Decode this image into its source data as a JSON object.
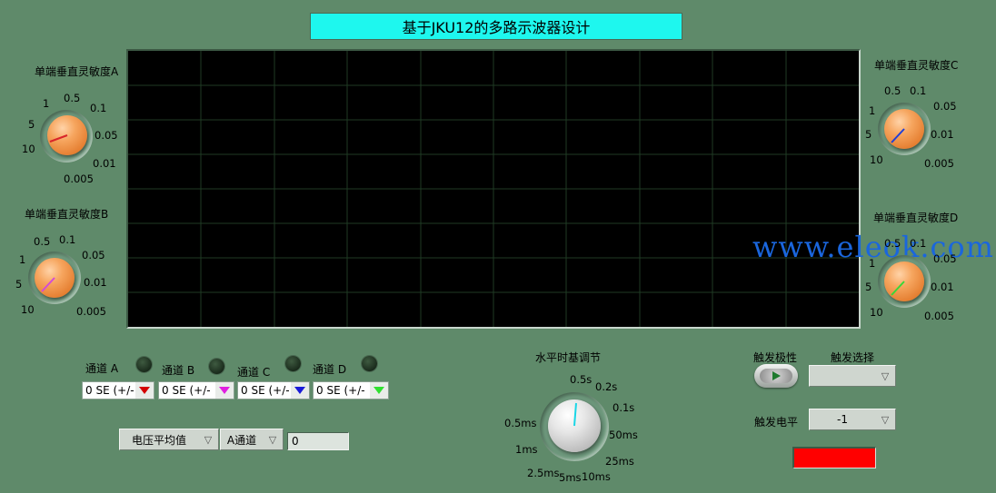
{
  "title": "基于JKU12的多路示波器设计",
  "watermark": "www.eleok.com",
  "knobs": {
    "a": {
      "label": "单端垂直灵敏度A",
      "ticks": [
        "1",
        "0.5",
        "0.1",
        "5",
        "0.05",
        "10",
        "0.01",
        "0.005"
      ],
      "needle_color": "#d8252a"
    },
    "b": {
      "label": "单端垂直灵敏度B",
      "ticks": [
        "0.5",
        "0.1",
        "1",
        "0.05",
        "5",
        "0.01",
        "10",
        "0.005"
      ],
      "needle_color": "#d24bd8"
    },
    "c": {
      "label": "单端垂直灵敏度C",
      "ticks": [
        "0.5",
        "0.1",
        "1",
        "0.05",
        "5",
        "0.01",
        "10",
        "0.005"
      ],
      "needle_color": "#1f3fd8"
    },
    "d": {
      "label": "单端垂直灵敏度D",
      "ticks": [
        "0.5",
        "0.1",
        "1",
        "0.05",
        "5",
        "0.01",
        "10",
        "0.005"
      ],
      "needle_color": "#38d838"
    }
  },
  "channels": [
    {
      "name": "通道 A",
      "value": "0 SE (+/-",
      "color": "#d40000"
    },
    {
      "name": "通道 B",
      "value": "0  SE (+/-",
      "color": "#e020e0"
    },
    {
      "name": "通道 C",
      "value": "0  SE (+/-",
      "color": "#1a1ad8"
    },
    {
      "name": "通道 D",
      "value": "0  SE (+/-",
      "color": "#30e030"
    }
  ],
  "measure": {
    "mode": "电压平均值",
    "channel": "A通道",
    "value": "0"
  },
  "timebase": {
    "label": "水平时基调节",
    "ticks": [
      "0.5s",
      "0.2s",
      "0.1s",
      "0.5ms",
      "50ms",
      "1ms",
      "25ms",
      "2.5ms",
      "5ms",
      "10ms"
    ],
    "needle_color": "#1ad6e6"
  },
  "trigger": {
    "polarity_label": "触发极性",
    "select_label": "触发选择",
    "select_value": "",
    "level_label": "触发电平",
    "level_value": "-1",
    "indicator_color": "#ff0000"
  }
}
